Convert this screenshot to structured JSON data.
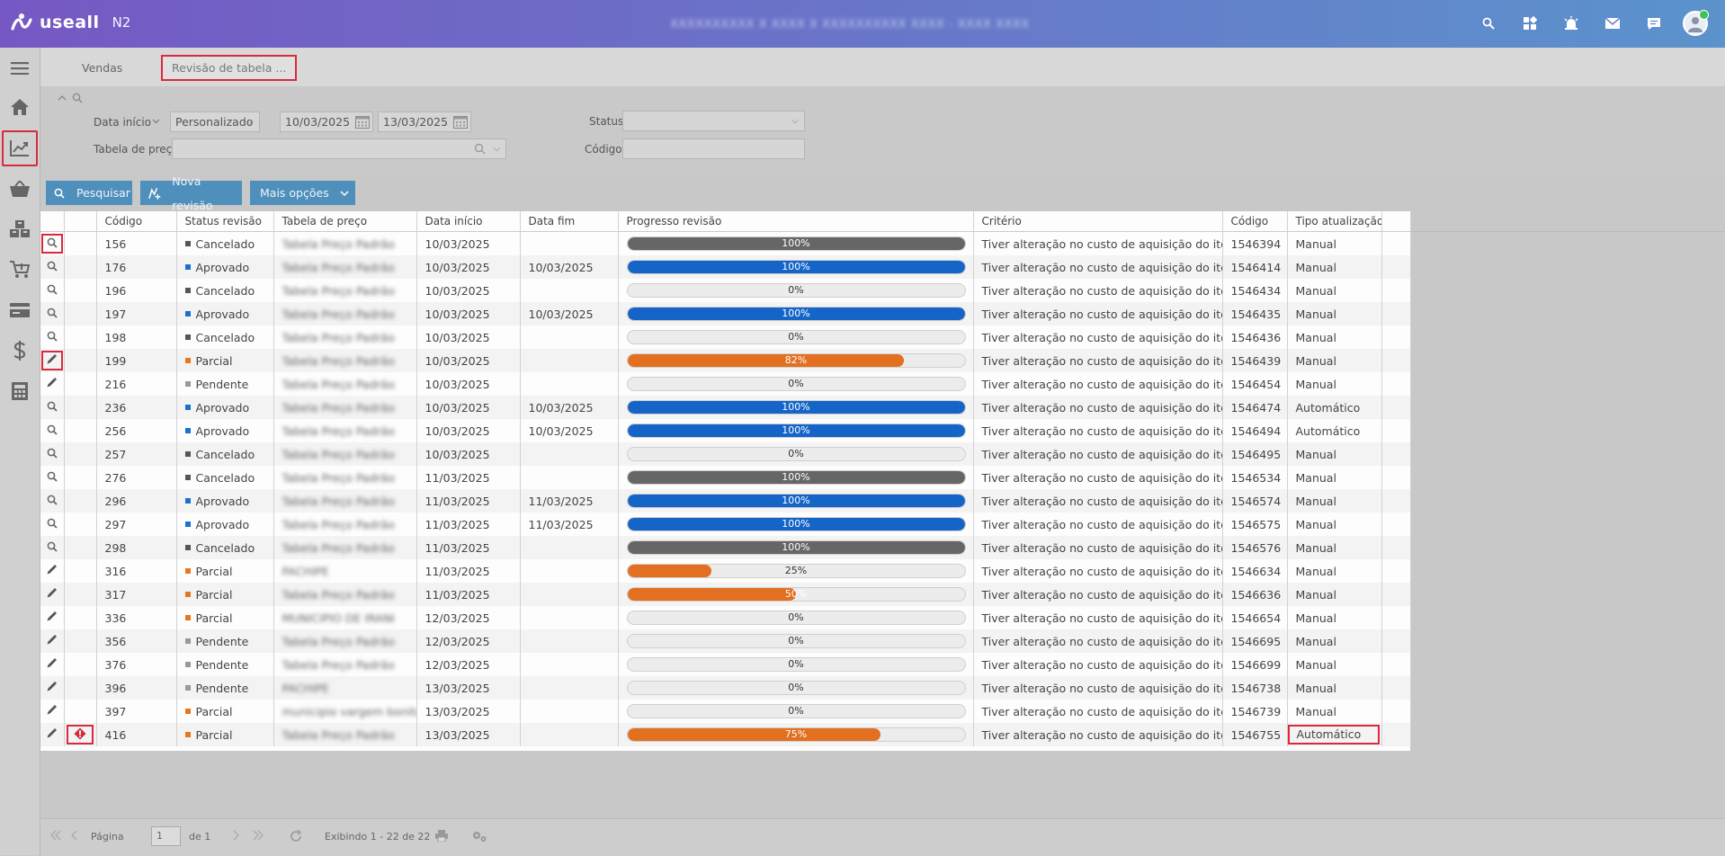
{
  "app": {
    "logo_text": "useall",
    "version": "N2",
    "company": "XXXXXXXXXX X XXXX X XXXXXXXXXX XXXX - XXXX XXXX"
  },
  "topbar_icons": [
    "search-icon",
    "grid-icon",
    "alarm-icon",
    "mail-icon",
    "chat-icon",
    "user-avatar"
  ],
  "sidebar": {
    "items": [
      {
        "name": "menu-icon"
      },
      {
        "name": "home-icon"
      },
      {
        "name": "sales-chart-icon",
        "selected": true
      },
      {
        "name": "basket-icon"
      },
      {
        "name": "boxes-icon"
      },
      {
        "name": "cart-icon"
      },
      {
        "name": "card-icon"
      },
      {
        "name": "dollar-icon"
      },
      {
        "name": "calculator-icon"
      }
    ]
  },
  "tabs": [
    {
      "label": "Vendas",
      "active": false
    },
    {
      "label": "Revisão de tabela ...",
      "active": true
    }
  ],
  "filters": {
    "date_label": "Data início",
    "period_value": "Personalizado",
    "date_from": "10/03/2025",
    "date_to": "13/03/2025",
    "status_label": "Status",
    "status_value": "",
    "price_table_label": "Tabela de preço",
    "price_table_value": "",
    "code_label": "Código",
    "code_value": ""
  },
  "buttons": {
    "search": "Pesquisar",
    "new_revision": "Nova revisão",
    "more_options": "Mais opções"
  },
  "columns": [
    "Código",
    "Status revisão",
    "Tabela de preço",
    "Data início",
    "Data fim",
    "Progresso revisão",
    "Critério",
    "Código",
    "Tipo atualização"
  ],
  "status_colors": {
    "Cancelado": "#555555",
    "Aprovado": "#1a6fd0",
    "Parcial": "#e8761c",
    "Pendente": "#999999"
  },
  "progress_colors": {
    "Cancelado": "#666666",
    "Aprovado": "#1565c8",
    "Parcial": "#e27020",
    "Pendente": "#e6e6e6"
  },
  "rows": [
    {
      "action": "view",
      "action_highlight": true,
      "alert": false,
      "codigo": "156",
      "status": "Cancelado",
      "tabela": "Tabela Preço Padrão",
      "inicio": "10/03/2025",
      "fim": "",
      "progress": 100,
      "progress_label": "100%",
      "criterio": "Tiver alteração no custo de aquisição do item",
      "codigo2": "1546394",
      "tipo": "Manual"
    },
    {
      "action": "view",
      "action_highlight": false,
      "alert": false,
      "codigo": "176",
      "status": "Aprovado",
      "tabela": "Tabela Preço Padrão",
      "inicio": "10/03/2025",
      "fim": "10/03/2025",
      "progress": 100,
      "progress_label": "100%",
      "criterio": "Tiver alteração no custo de aquisição do item",
      "codigo2": "1546414",
      "tipo": "Manual"
    },
    {
      "action": "view",
      "action_highlight": false,
      "alert": false,
      "codigo": "196",
      "status": "Cancelado",
      "tabela": "Tabela Preço Padrão",
      "inicio": "10/03/2025",
      "fim": "",
      "progress": 0,
      "progress_label": "0%",
      "criterio": "Tiver alteração no custo de aquisição do item",
      "codigo2": "1546434",
      "tipo": "Manual"
    },
    {
      "action": "view",
      "action_highlight": false,
      "alert": false,
      "codigo": "197",
      "status": "Aprovado",
      "tabela": "Tabela Preço Padrão",
      "inicio": "10/03/2025",
      "fim": "10/03/2025",
      "progress": 100,
      "progress_label": "100%",
      "criterio": "Tiver alteração no custo de aquisição do item",
      "codigo2": "1546435",
      "tipo": "Manual"
    },
    {
      "action": "view",
      "action_highlight": false,
      "alert": false,
      "codigo": "198",
      "status": "Cancelado",
      "tabela": "Tabela Preço Padrão",
      "inicio": "10/03/2025",
      "fim": "",
      "progress": 0,
      "progress_label": "0%",
      "criterio": "Tiver alteração no custo de aquisição do item",
      "codigo2": "1546436",
      "tipo": "Manual"
    },
    {
      "action": "edit",
      "action_highlight": true,
      "alert": false,
      "codigo": "199",
      "status": "Parcial",
      "tabela": "Tabela Preço Padrão",
      "inicio": "10/03/2025",
      "fim": "",
      "progress": 82,
      "progress_label": "82%",
      "criterio": "Tiver alteração no custo de aquisição do item",
      "codigo2": "1546439",
      "tipo": "Manual"
    },
    {
      "action": "edit",
      "action_highlight": false,
      "alert": false,
      "codigo": "216",
      "status": "Pendente",
      "tabela": "Tabela Preço Padrão",
      "inicio": "10/03/2025",
      "fim": "",
      "progress": 0,
      "progress_label": "0%",
      "criterio": "Tiver alteração no custo de aquisição do item",
      "codigo2": "1546454",
      "tipo": "Manual"
    },
    {
      "action": "view",
      "action_highlight": false,
      "alert": false,
      "codigo": "236",
      "status": "Aprovado",
      "tabela": "Tabela Preço Padrão",
      "inicio": "10/03/2025",
      "fim": "10/03/2025",
      "progress": 100,
      "progress_label": "100%",
      "criterio": "Tiver alteração no custo de aquisição do item",
      "codigo2": "1546474",
      "tipo": "Automático"
    },
    {
      "action": "view",
      "action_highlight": false,
      "alert": false,
      "codigo": "256",
      "status": "Aprovado",
      "tabela": "Tabela Preço Padrão",
      "inicio": "10/03/2025",
      "fim": "10/03/2025",
      "progress": 100,
      "progress_label": "100%",
      "criterio": "Tiver alteração no custo de aquisição do item",
      "codigo2": "1546494",
      "tipo": "Automático"
    },
    {
      "action": "view",
      "action_highlight": false,
      "alert": false,
      "codigo": "257",
      "status": "Cancelado",
      "tabela": "Tabela Preço Padrão",
      "inicio": "10/03/2025",
      "fim": "",
      "progress": 0,
      "progress_label": "0%",
      "criterio": "Tiver alteração no custo de aquisição do item",
      "codigo2": "1546495",
      "tipo": "Manual"
    },
    {
      "action": "view",
      "action_highlight": false,
      "alert": false,
      "codigo": "276",
      "status": "Cancelado",
      "tabela": "Tabela Preço Padrão",
      "inicio": "11/03/2025",
      "fim": "",
      "progress": 100,
      "progress_label": "100%",
      "criterio": "Tiver alteração no custo de aquisição do item",
      "codigo2": "1546534",
      "tipo": "Manual"
    },
    {
      "action": "view",
      "action_highlight": false,
      "alert": false,
      "codigo": "296",
      "status": "Aprovado",
      "tabela": "Tabela Preço Padrão",
      "inicio": "11/03/2025",
      "fim": "11/03/2025",
      "progress": 100,
      "progress_label": "100%",
      "criterio": "Tiver alteração no custo de aquisição do item",
      "codigo2": "1546574",
      "tipo": "Manual"
    },
    {
      "action": "view",
      "action_highlight": false,
      "alert": false,
      "codigo": "297",
      "status": "Aprovado",
      "tabela": "Tabela Preço Padrão",
      "inicio": "11/03/2025",
      "fim": "11/03/2025",
      "progress": 100,
      "progress_label": "100%",
      "criterio": "Tiver alteração no custo de aquisição do item",
      "codigo2": "1546575",
      "tipo": "Manual"
    },
    {
      "action": "view",
      "action_highlight": false,
      "alert": false,
      "codigo": "298",
      "status": "Cancelado",
      "tabela": "Tabela Preço Padrão",
      "inicio": "11/03/2025",
      "fim": "",
      "progress": 100,
      "progress_label": "100%",
      "criterio": "Tiver alteração no custo de aquisição do item",
      "codigo2": "1546576",
      "tipo": "Manual"
    },
    {
      "action": "edit",
      "action_highlight": false,
      "alert": false,
      "codigo": "316",
      "status": "Parcial",
      "tabela": "PACHIPE",
      "inicio": "11/03/2025",
      "fim": "",
      "progress": 25,
      "progress_label": "25%",
      "criterio": "Tiver alteração no custo de aquisição do item",
      "codigo2": "1546634",
      "tipo": "Manual"
    },
    {
      "action": "edit",
      "action_highlight": false,
      "alert": false,
      "codigo": "317",
      "status": "Parcial",
      "tabela": "Tabela Preço Padrão",
      "inicio": "11/03/2025",
      "fim": "",
      "progress": 50,
      "progress_label": "50%",
      "criterio": "Tiver alteração no custo de aquisição do item",
      "codigo2": "1546636",
      "tipo": "Manual"
    },
    {
      "action": "edit",
      "action_highlight": false,
      "alert": false,
      "codigo": "336",
      "status": "Parcial",
      "tabela": "MUNICIPIO DE IRANI",
      "inicio": "12/03/2025",
      "fim": "",
      "progress": 0,
      "progress_label": "0%",
      "criterio": "Tiver alteração no custo de aquisição do item",
      "codigo2": "1546654",
      "tipo": "Manual"
    },
    {
      "action": "edit",
      "action_highlight": false,
      "alert": false,
      "codigo": "356",
      "status": "Pendente",
      "tabela": "Tabela Preço Padrão",
      "inicio": "12/03/2025",
      "fim": "",
      "progress": 0,
      "progress_label": "0%",
      "criterio": "Tiver alteração no custo de aquisição do item",
      "codigo2": "1546695",
      "tipo": "Manual"
    },
    {
      "action": "edit",
      "action_highlight": false,
      "alert": false,
      "codigo": "376",
      "status": "Pendente",
      "tabela": "Tabela Preço Padrão",
      "inicio": "12/03/2025",
      "fim": "",
      "progress": 0,
      "progress_label": "0%",
      "criterio": "Tiver alteração no custo de aquisição do item",
      "codigo2": "1546699",
      "tipo": "Manual"
    },
    {
      "action": "edit",
      "action_highlight": false,
      "alert": false,
      "codigo": "396",
      "status": "Pendente",
      "tabela": "PACHIPE",
      "inicio": "13/03/2025",
      "fim": "",
      "progress": 0,
      "progress_label": "0%",
      "criterio": "Tiver alteração no custo de aquisição do item",
      "codigo2": "1546738",
      "tipo": "Manual"
    },
    {
      "action": "edit",
      "action_highlight": false,
      "alert": false,
      "codigo": "397",
      "status": "Parcial",
      "tabela": "municipio vargem bonita",
      "inicio": "13/03/2025",
      "fim": "",
      "progress": 0,
      "progress_label": "0%",
      "criterio": "Tiver alteração no custo de aquisição do item",
      "codigo2": "1546739",
      "tipo": "Manual"
    },
    {
      "action": "edit",
      "action_highlight": false,
      "alert": true,
      "codigo": "416",
      "status": "Parcial",
      "tabela": "Tabela Preço Padrão",
      "inicio": "13/03/2025",
      "fim": "",
      "progress": 75,
      "progress_label": "75%",
      "criterio": "Tiver alteração no custo de aquisição do item",
      "codigo2": "1546755",
      "tipo": "Automático",
      "tipo_highlight": true
    }
  ],
  "footer": {
    "page_label": "Página",
    "page_value": "1",
    "of_label": "de 1",
    "showing": "Exibindo 1 - 22 de 22"
  }
}
